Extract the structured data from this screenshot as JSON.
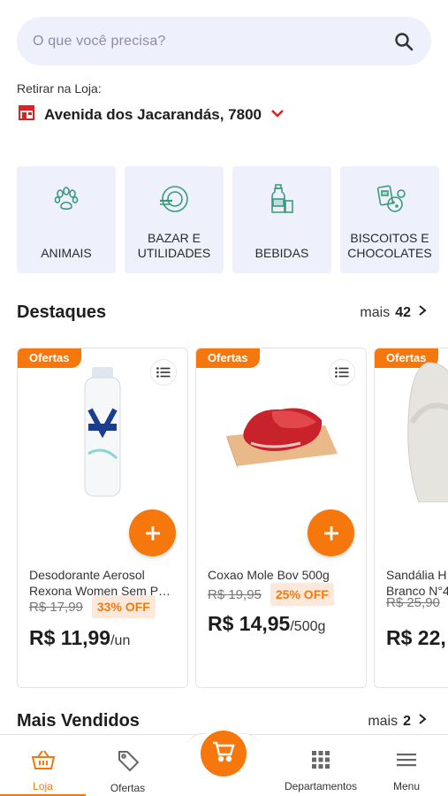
{
  "search": {
    "placeholder": "O que você precisa?",
    "icon": "search-icon"
  },
  "pickup": {
    "label": "Retirar na Loja:",
    "store": "Avenida dos Jacarandás, 7800",
    "accent": "#e02020"
  },
  "categories": [
    {
      "line1": "ANIMAIS",
      "line2": "",
      "icon": "paw-icon"
    },
    {
      "line1": "BAZAR E",
      "line2": "UTILIDADES",
      "icon": "plate-icon"
    },
    {
      "line1": "BEBIDAS",
      "line2": "",
      "icon": "bottle-icon"
    },
    {
      "line1": "BISCOITOS E",
      "line2": "CHOCOLATES",
      "icon": "cookies-icon"
    }
  ],
  "highlights": {
    "title": "Destaques",
    "more_label": "mais",
    "more_count": "42"
  },
  "products": [
    {
      "badge": "Ofertas",
      "name1": "Desodorante Aerosol",
      "name2": "Rexona Women Sem Perfume",
      "old_price": "R$ 17,99",
      "discount": "33% OFF",
      "price": "R$ 11,99",
      "unit": "/un"
    },
    {
      "badge": "Ofertas",
      "name1": "Coxao Mole Bov 500g",
      "name2": "",
      "old_price": "R$ 19,95",
      "discount": "25% OFF",
      "price": "R$ 14,95",
      "unit": "/500g"
    },
    {
      "badge": "Ofertas",
      "name1": "Sandália H",
      "name2": "Branco N°4",
      "old_price": "R$ 25,90",
      "discount": "",
      "price": "R$ 22,",
      "unit": ""
    }
  ],
  "best_sellers": {
    "title": "Mais Vendidos",
    "more_label": "mais",
    "more_count": "2"
  },
  "nav": {
    "store": "Loja",
    "offers": "Ofertas",
    "departments": "Departamentos",
    "menu": "Menu"
  },
  "colors": {
    "accent": "#f6780c",
    "chip_bg": "#eef0fb",
    "icon_green": "#3a9b7a"
  }
}
